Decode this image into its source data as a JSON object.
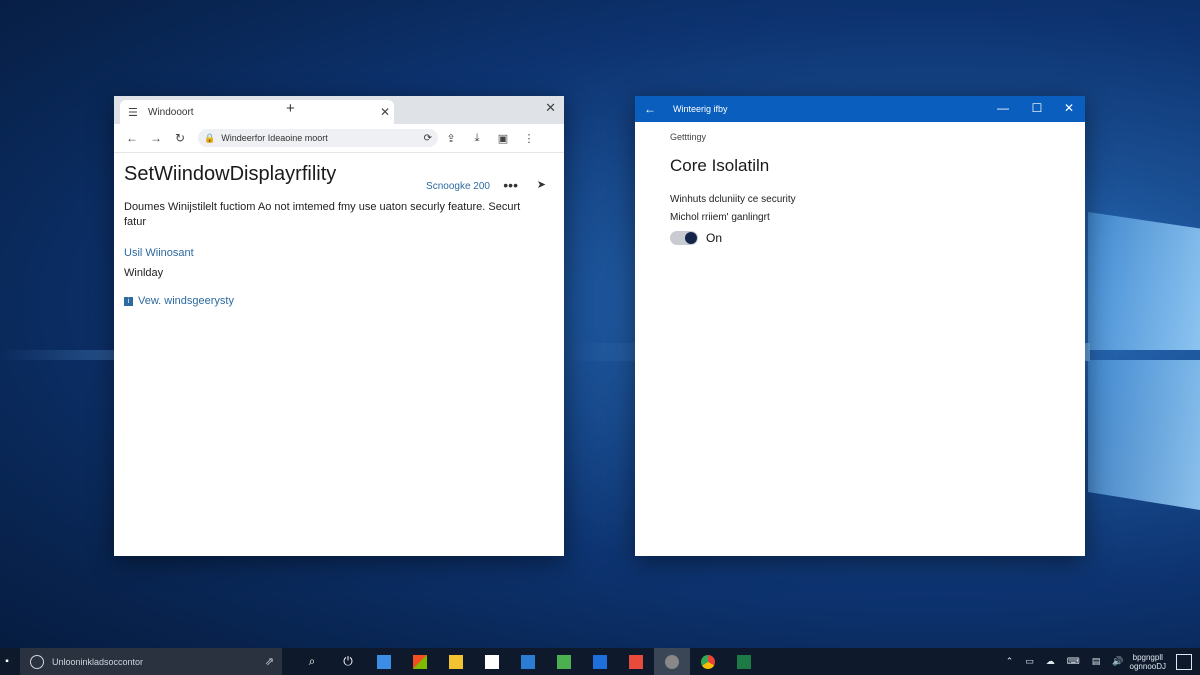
{
  "browser": {
    "tab_title": "Windooort",
    "tab_close": "✕",
    "new_tab": "+",
    "window_close": "✕",
    "address": "Windeerfor Ideaoine moort",
    "page": {
      "title": "SetWiindowDisplayrfility",
      "meta": "Scnoogke 200",
      "more": "•••",
      "description": "Doumes Winijstilelt fuctiom Ao not imtemed fmy use uaton securly feature. Securt fatur",
      "link1": "Usil Wiinosant",
      "text2": "Winlday",
      "link2": "Vew. windsgeerysty"
    }
  },
  "settings": {
    "title": "Winteerig ifby",
    "breadcrumb": "Getttingy",
    "heading": "Core Isolatiln",
    "desc1": "Winhuts dcluniity ce security",
    "desc2": "Michol rriiem' ganlingrt",
    "toggle_label": "On",
    "toggle_state": true
  },
  "taskbar": {
    "search_placeholder": "Unlooninkladsoccontor",
    "clock_line1": "bpgngpll",
    "clock_line2": "ognnooDJ"
  },
  "colors": {
    "settings_titlebar": "#0a5fbe",
    "link": "#2c6aa0",
    "toggle_knob": "#14254a",
    "taskbar": "#0e1a2c"
  }
}
